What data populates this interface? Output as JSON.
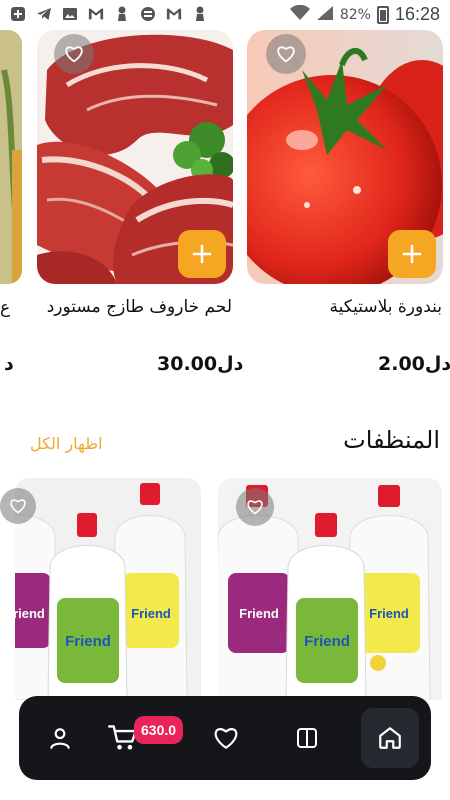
{
  "status_bar": {
    "battery": "82%",
    "time": "16:28",
    "left_icons": [
      "plus-box-icon",
      "telegram-icon",
      "image-icon",
      "gmail-icon",
      "pin-icon",
      "sync-icon",
      "gmail-icon",
      "pin-icon"
    ]
  },
  "products_row": [
    {
      "name": "بندورة بلاستيكية",
      "price": "دل2.00",
      "image": "tomato"
    },
    {
      "name": "لحم خاروف طازج مستورد",
      "price": "دل30.00",
      "image": "lamb-meat"
    },
    {
      "name": "ع",
      "price": "د",
      "image": "partial"
    }
  ],
  "section": {
    "title": "المنظفات",
    "show_all": "اظهار الكل"
  },
  "detergent_row": [
    {
      "image": "detergent-bottles",
      "brand": "Friend"
    },
    {
      "image": "detergent-bottles",
      "brand": "Friend"
    }
  ],
  "bottom_nav": {
    "cart_count": "630.0",
    "items": [
      "profile-icon",
      "cart-icon",
      "heart-icon",
      "split-view-icon",
      "home-icon"
    ],
    "active": "home-icon"
  },
  "colors": {
    "accent": "#f5a623",
    "badge": "#e8245a",
    "nav_bg": "#14161a",
    "show_all": "#f0a830"
  }
}
